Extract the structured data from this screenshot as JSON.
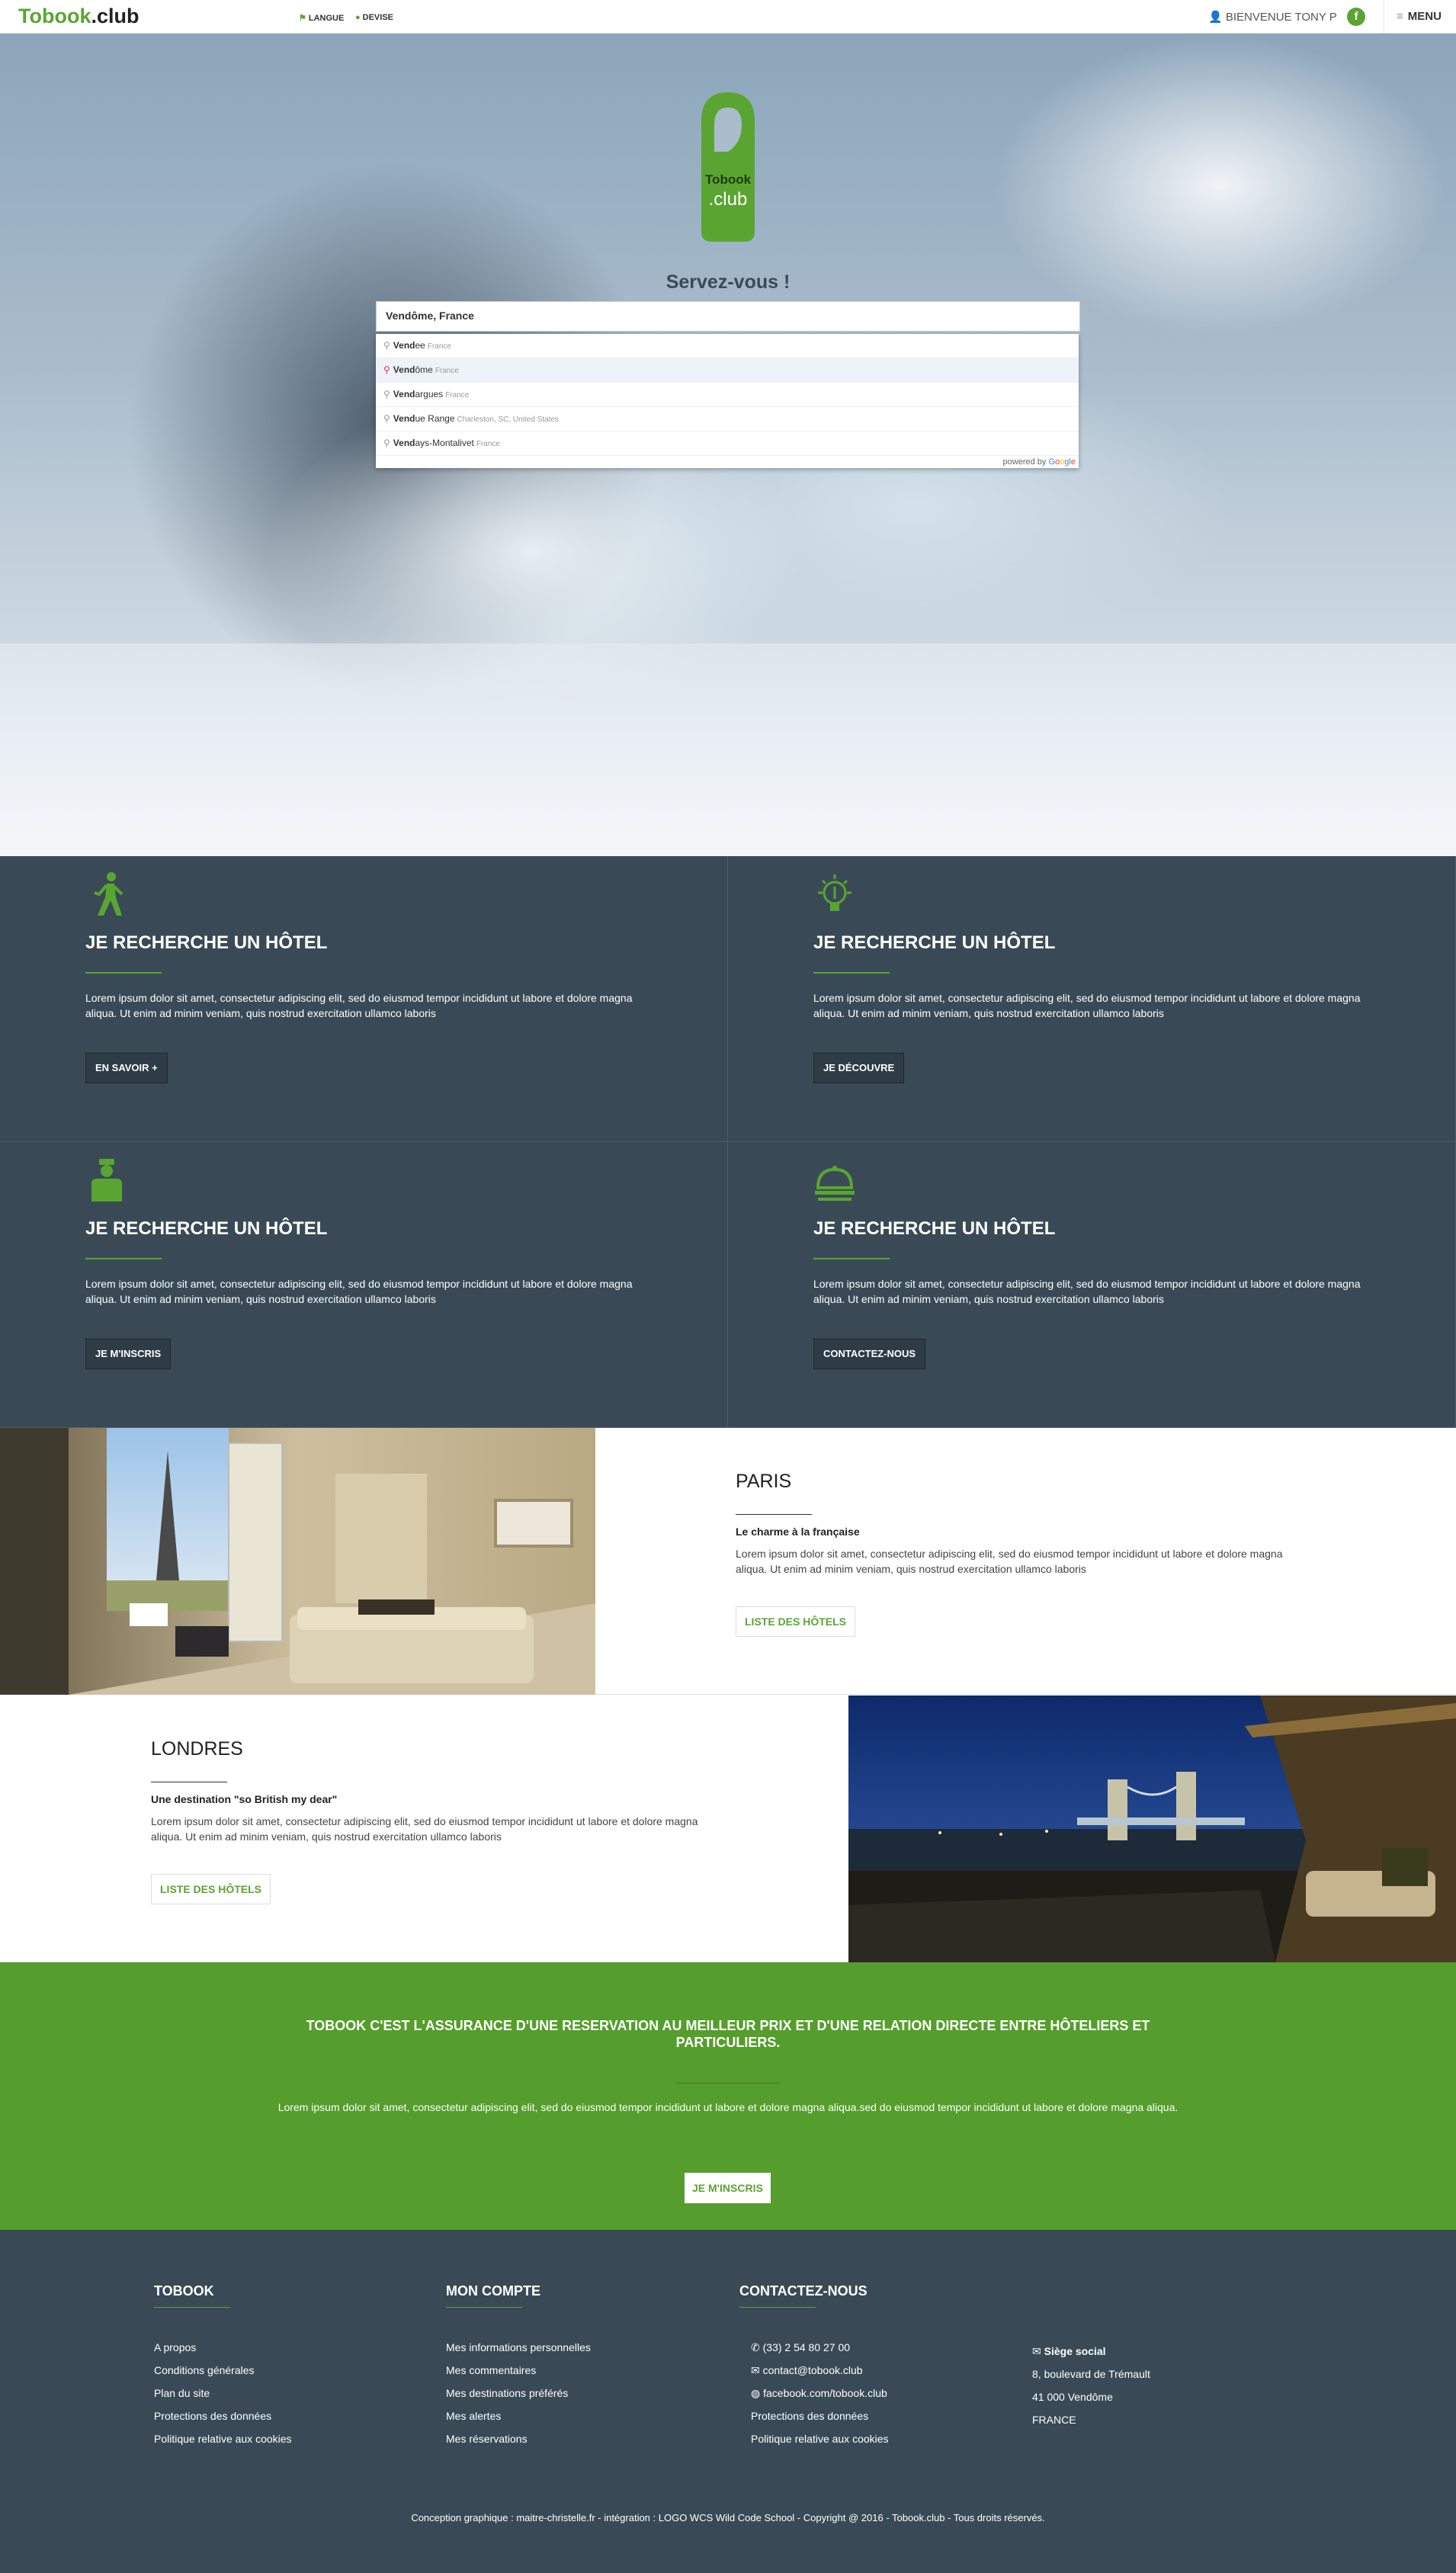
{
  "header": {
    "logo_brand": "Tobook",
    "logo_suffix": ".club",
    "langue": "LANGUE",
    "devise": "DEVISE",
    "welcome": "BIENVENUE TONY P",
    "facebook": "f",
    "menu": "MENU"
  },
  "hero": {
    "tag_line1": "Tobook",
    "tag_line2": ".club",
    "tagline": "Servez-vous !",
    "search_value": "Vendôme, France",
    "suggestions": [
      {
        "bold": "Vend",
        "rest": "ee",
        "secondary": "France"
      },
      {
        "bold": "Vend",
        "rest": "ôme",
        "secondary": "France"
      },
      {
        "bold": "Vend",
        "rest": "argues",
        "secondary": "France"
      },
      {
        "bold": "Vend",
        "rest": "ue Range",
        "secondary": "Charleston, SC, United States"
      },
      {
        "bold": "Vend",
        "rest": "ays-Montalivet",
        "secondary": "France"
      }
    ],
    "powered_by": "powered by"
  },
  "features": [
    {
      "icon": "walking-person-icon",
      "title": "JE RECHERCHE UN HÔTEL",
      "text": "Lorem ipsum dolor sit amet, consectetur adipiscing elit, sed do eiusmod tempor incididunt ut labore et dolore magna aliqua. Ut enim ad minim veniam, quis nostrud exercitation ullamco laboris",
      "button": "EN SAVOIR +"
    },
    {
      "icon": "lightbulb-icon",
      "title": "JE RECHERCHE UN HÔTEL",
      "text": "Lorem ipsum dolor sit amet, consectetur adipiscing elit, sed do eiusmod tempor incididunt ut labore et dolore magna aliqua. Ut enim ad minim veniam, quis nostrud exercitation ullamco laboris",
      "button": "JE DÉCOUVRE"
    },
    {
      "icon": "bellboy-icon",
      "title": "JE RECHERCHE UN HÔTEL",
      "text": "Lorem ipsum dolor sit amet, consectetur adipiscing elit, sed do eiusmod tempor incididunt ut labore et dolore magna aliqua. Ut enim ad minim veniam, quis nostrud exercitation ullamco laboris",
      "button": "JE M'INSCRIS"
    },
    {
      "icon": "service-bell-icon",
      "title": "JE RECHERCHE UN HÔTEL",
      "text": "Lorem ipsum dolor sit amet, consectetur adipiscing elit, sed do eiusmod tempor incididunt ut labore et dolore magna aliqua. Ut enim ad minim veniam, quis nostrud exercitation ullamco laboris",
      "button": "CONTACTEZ-NOUS"
    }
  ],
  "cities": [
    {
      "name": "PARIS",
      "subtitle": "Le charme à la française",
      "text": "Lorem ipsum dolor sit amet, consectetur adipiscing elit, sed do eiusmod tempor incididunt ut labore et dolore magna aliqua. Ut enim ad minim veniam, quis nostrud exercitation ullamco laboris",
      "button": "LISTE DES HÔTELS"
    },
    {
      "name": "LONDRES",
      "subtitle": "Une destination \"so British my dear\"",
      "text": "Lorem ipsum dolor sit amet, consectetur adipiscing elit, sed do eiusmod tempor incididunt ut labore et dolore magna aliqua. Ut enim ad minim veniam, quis nostrud exercitation ullamco laboris",
      "button": "LISTE DES HÔTELS"
    }
  ],
  "banner": {
    "title": "TOBOOK C'EST L'ASSURANCE D'UNE RESERVATION AU MEILLEUR PRIX ET D'UNE RELATION DIRECTE ENTRE HÔTELIERS ET PARTICULIERS.",
    "text": "Lorem ipsum dolor sit amet, consectetur adipiscing elit, sed do eiusmod tempor incididunt ut labore et dolore magna aliqua.sed do eiusmod tempor incididunt ut labore et dolore magna aliqua.",
    "button": "JE M'INSCRIS"
  },
  "footer": {
    "col1": {
      "title": "TOBOOK",
      "links": [
        "A propos",
        "Conditions générales",
        "Plan du site",
        "Protections des données",
        "Politique relative aux cookies"
      ]
    },
    "col2": {
      "title": "MON COMPTE",
      "links": [
        "Mes informations personnelles",
        "Mes commentaires",
        "Mes destinations préférés",
        "Mes alertes",
        "Mes réservations"
      ]
    },
    "col3": {
      "title": "CONTACTEZ-NOUS",
      "phone": "(33) 2 54 80 27 00",
      "email": "contact@tobook.club",
      "facebook": "facebook.com/tobook.club",
      "links": [
        "Protections des données",
        "Politique relative aux cookies"
      ]
    },
    "col4": {
      "title": "Siège social",
      "address": [
        "8, boulevard de Trémault",
        "41 000 Vendôme",
        "FRANCE"
      ]
    },
    "copyright": "Conception graphique : maitre-christelle.fr - intégration : LOGO WCS Wild Code School - Copyright @ 2016 - Tobook.club - Tous droits réservés."
  },
  "colors": {
    "accent": "#5aa532",
    "dark": "#394a56",
    "banner": "#559d2c"
  }
}
